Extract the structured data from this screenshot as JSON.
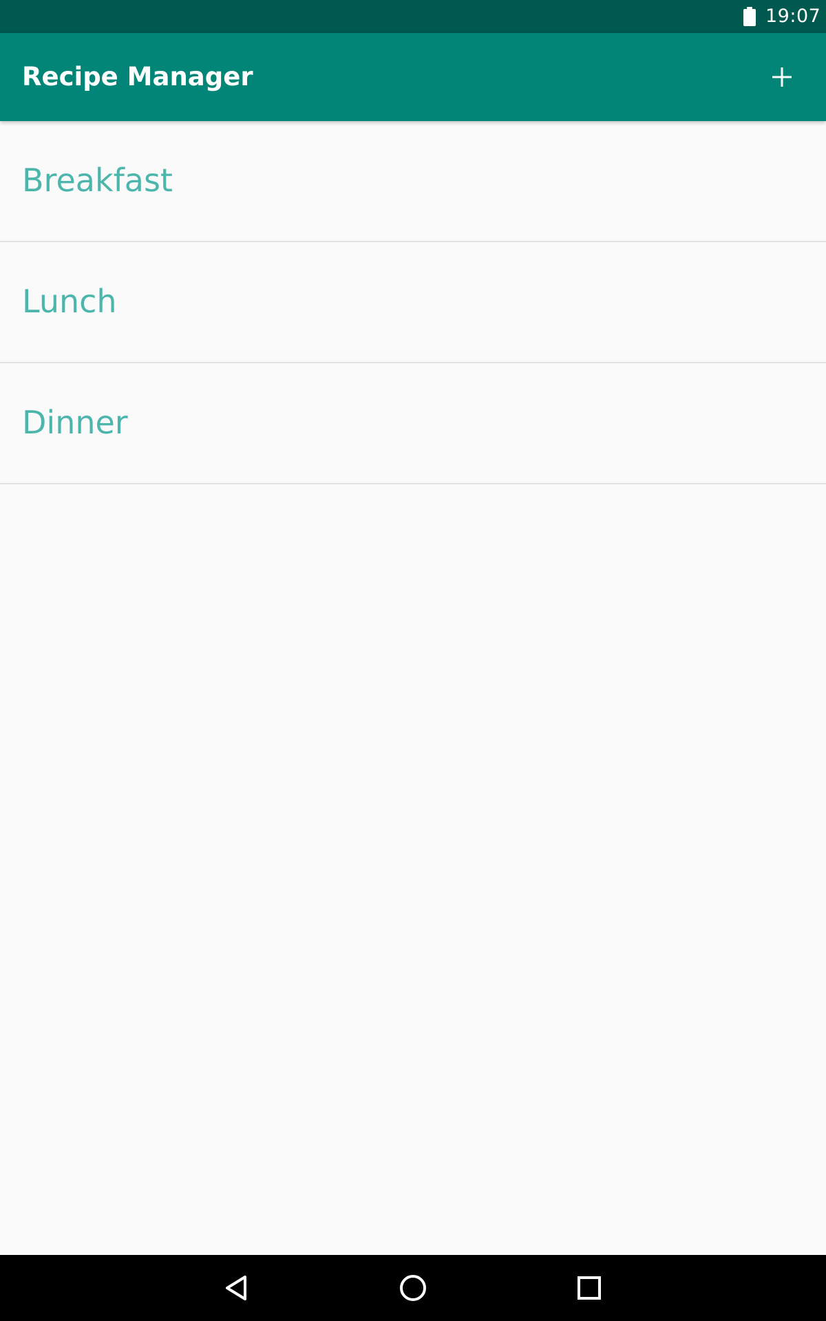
{
  "status_bar": {
    "time": "19:07",
    "battery_icon": "battery-full-icon"
  },
  "app_bar": {
    "title": "Recipe Manager",
    "action_icon": "plus-icon"
  },
  "list": {
    "items": [
      {
        "label": "Breakfast"
      },
      {
        "label": "Lunch"
      },
      {
        "label": "Dinner"
      }
    ]
  },
  "nav_bar": {
    "back_icon": "back-triangle-icon",
    "home_icon": "home-circle-icon",
    "recents_icon": "recents-square-icon"
  },
  "colors": {
    "status_bar": "#00594f",
    "app_bar": "#008577",
    "list_text": "#4db6ac",
    "background": "#fafafa"
  }
}
